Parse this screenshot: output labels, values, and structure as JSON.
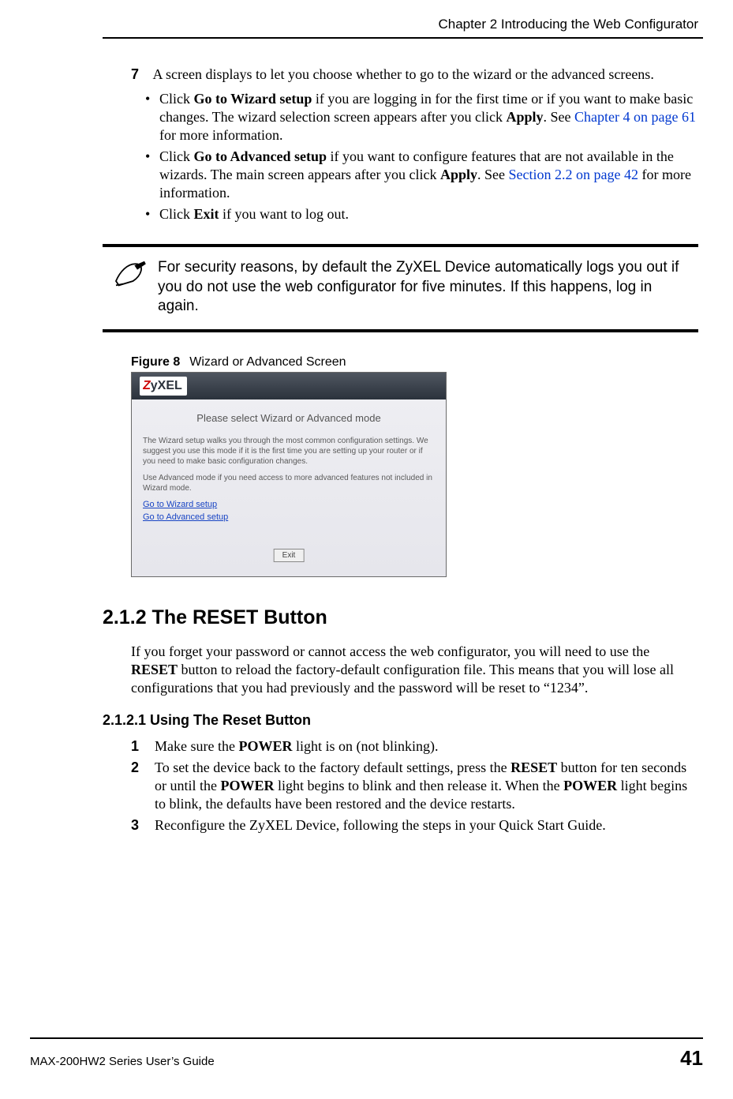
{
  "running_head": "Chapter 2 Introducing the Web Configurator",
  "step7": {
    "num": "7",
    "text": "A screen displays to let you choose whether to go to the wizard or the advanced screens."
  },
  "bullets": [
    {
      "p1": "Click ",
      "b1": "Go to Wizard setup",
      "p2": " if you are logging in for the first time or if you want to make basic changes. The wizard selection screen appears after you click ",
      "b2": "Apply",
      "p3": ". See ",
      "x1": "Chapter 4 on page 61",
      "p4": " for more information."
    },
    {
      "p1": "Click ",
      "b1": "Go to Advanced setup",
      "p2": " if you want to configure features that are not available in the wizards. The main screen appears after you click ",
      "b2": "Apply",
      "p3": ". See ",
      "x1": "Section 2.2 on page 42",
      "p4": " for more information."
    },
    {
      "p1": "Click ",
      "b1": "Exit",
      "p2": " if you want to log out."
    }
  ],
  "note_text": "For security reasons, by default the ZyXEL Device automatically logs you out if you do not use the web configurator for five minutes. If this happens, log in again.",
  "figure": {
    "label": "Figure 8",
    "caption": "Wizard or Advanced Screen",
    "logo": "ZyXEL",
    "title": "Please select Wizard or Advanced mode",
    "para1": "The Wizard setup walks you through the most common configuration settings. We suggest you use this mode if it is the first time you are setting up your router or if you need to make basic configuration changes.",
    "para2": "Use Advanced mode if you need access to more advanced features not included in Wizard mode.",
    "link1": "Go to Wizard setup",
    "link2": "Go to Advanced setup",
    "exit": "Exit"
  },
  "sec212": {
    "heading": "2.1.2  The RESET Button",
    "p_1": "If you forget your password or cannot access the web configurator, you will need to use the ",
    "p_b1": "RESET",
    "p_2": " button to reload the factory-default configuration file. This means that you will lose all configurations that you had previously and the password will be reset to “1234”."
  },
  "sec2121": {
    "heading": "2.1.2.1  Using The Reset Button",
    "items": [
      {
        "n": "1",
        "p1": "Make sure the ",
        "b1": "POWER",
        "p2": " light is on (not blinking)."
      },
      {
        "n": "2",
        "p1": "To set the device back to the factory default settings, press the ",
        "b1": "RESET",
        "p2": " button for ten seconds or until the ",
        "b2": "POWER",
        "p3": " light begins to blink and then release it. When the ",
        "b3": "POWER",
        "p4": " light begins to blink, the defaults have been restored and the device restarts."
      },
      {
        "n": "3",
        "p1": "Reconfigure the ZyXEL Device, following the steps in your Quick Start Guide."
      }
    ]
  },
  "footer": {
    "left": "MAX-200HW2 Series User’s Guide",
    "page": "41"
  }
}
